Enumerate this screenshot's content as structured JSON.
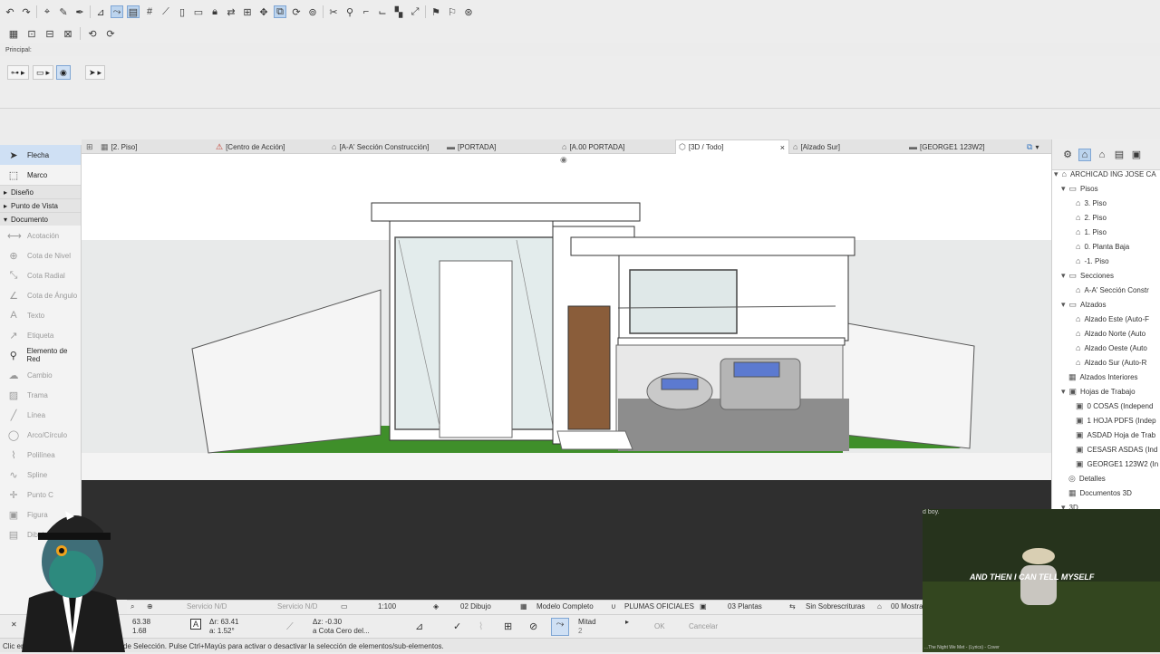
{
  "toolbar": {
    "principal_label": "Principal:"
  },
  "toolbox": {
    "tools_top": [
      {
        "label": "Flecha",
        "icon": "arrow-icon"
      },
      {
        "label": "Marco",
        "icon": "marquee-icon"
      }
    ],
    "categories": [
      "Diseño",
      "Punto de Vista",
      "Documento"
    ],
    "tools": [
      {
        "label": "Acotación",
        "icon": "dimension-icon"
      },
      {
        "label": "Cota de Nivel",
        "icon": "level-dimension-icon"
      },
      {
        "label": "Cota Radial",
        "icon": "radial-dimension-icon"
      },
      {
        "label": "Cota de Ángulo",
        "icon": "angle-dimension-icon"
      },
      {
        "label": "Texto",
        "icon": "text-icon"
      },
      {
        "label": "Etiqueta",
        "icon": "label-icon"
      },
      {
        "label": "Elemento de Red",
        "icon": "grid-element-icon"
      },
      {
        "label": "Cambio",
        "icon": "change-icon"
      },
      {
        "label": "Trama",
        "icon": "fill-icon"
      },
      {
        "label": "Línea",
        "icon": "line-icon"
      },
      {
        "label": "Arco/Círculo",
        "icon": "arc-icon"
      },
      {
        "label": "Polilínea",
        "icon": "polyline-icon"
      },
      {
        "label": "Spline",
        "icon": "spline-icon"
      },
      {
        "label": "Punto C",
        "icon": "hotspot-icon"
      },
      {
        "label": "Figura",
        "icon": "figure-icon"
      },
      {
        "label": "Dibujo",
        "icon": "drawing-icon"
      }
    ]
  },
  "tabs": [
    {
      "label": "[2. Piso]"
    },
    {
      "label": "[Centro de Acción]"
    },
    {
      "label": "[A-A' Sección Construcción]"
    },
    {
      "label": "[PORTADA]"
    },
    {
      "label": "[A.00 PORTADA]"
    },
    {
      "label": "[3D / Todo]",
      "close": "×"
    },
    {
      "label": "[Alzado Sur]"
    },
    {
      "label": "[GEORGE1 123W2]"
    }
  ],
  "navigator": {
    "items": [
      {
        "label": "ARCHICAD ING JOSE CA"
      },
      {
        "label": "Pisos"
      },
      {
        "label": "3. Piso"
      },
      {
        "label": "2. Piso"
      },
      {
        "label": "1. Piso"
      },
      {
        "label": "0. Planta Baja"
      },
      {
        "label": "-1. Piso"
      },
      {
        "label": "Secciones"
      },
      {
        "label": "A-A' Sección Constr"
      },
      {
        "label": "Alzados"
      },
      {
        "label": "Alzado Este (Auto-F"
      },
      {
        "label": "Alzado Norte (Auto"
      },
      {
        "label": "Alzado Oeste (Auto"
      },
      {
        "label": "Alzado Sur (Auto-R"
      },
      {
        "label": "Alzados Interiores"
      },
      {
        "label": "Hojas de Trabajo"
      },
      {
        "label": "0 COSAS (Independ"
      },
      {
        "label": "1 HOJA PDFS (Indep"
      },
      {
        "label": "ASDAD Hoja de Trab"
      },
      {
        "label": "CESASR ASDAS (Ind"
      },
      {
        "label": "GEORGE1 123W2 (In"
      },
      {
        "label": "Detalles"
      },
      {
        "label": "Documentos 3D"
      },
      {
        "label": "3D"
      }
    ]
  },
  "viewbar": {
    "servicio1": "Servicio N/D",
    "servicio2": "Servicio N/D",
    "scale": "1:100",
    "layer_combo": "02 Dibujo",
    "model_view": "Modelo Completo",
    "pen_set": "PLUMAS OFICIALES",
    "floor_plan": "03 Plantas",
    "overrides": "Sin Sobrescrituras",
    "markers": "00 Mostra"
  },
  "infobox": {
    "x_value": "63.38",
    "y_value": "1.68",
    "dx_value": "Δr: 63.41",
    "angle_value": "a: 1.52°",
    "dz_value": "Δz: -0.30",
    "ref_level": "a Cota Cero del...",
    "mitad_label": "Mitad",
    "mitad_value": "2",
    "ok_label": "OK",
    "cancel_label": "Cancelar"
  },
  "status": {
    "text_left": "Clic en",
    "text_right": "de Selección. Pulse Ctrl+Mayús para activar o desactivar la selección de elementos/sub-elementos."
  },
  "webcam": {
    "top_caption": "d boy.",
    "subtitle": "AND THEN I CAN TELL MYSELF",
    "bottom_text": "...The Night We Met - (Lyrics) - Cover"
  }
}
